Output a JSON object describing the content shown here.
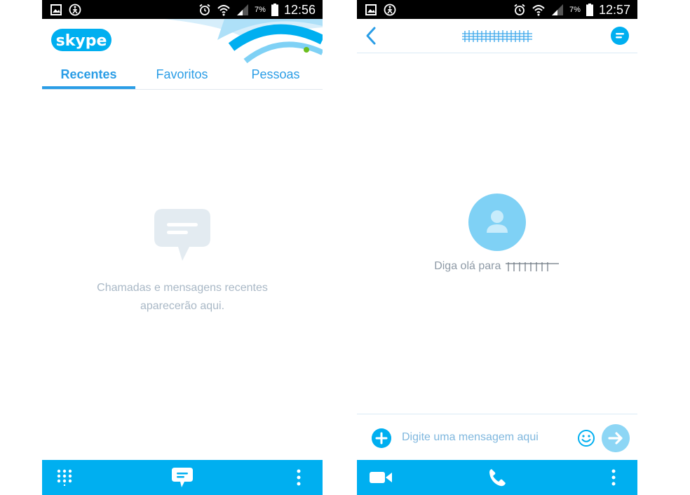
{
  "left_screen": {
    "status_bar": {
      "battery": "7%",
      "time": "12:56",
      "icons_left": [
        "image-icon",
        "person-running-icon"
      ],
      "icons_right": [
        "alarm-icon",
        "wifi-icon",
        "signal-icon",
        "battery-icon"
      ]
    },
    "logo_text": "skype",
    "tabs": [
      {
        "label": "Recentes",
        "active": true
      },
      {
        "label": "Favoritos",
        "active": false
      },
      {
        "label": "Pessoas",
        "active": false
      }
    ],
    "empty_state": {
      "line1": "Chamadas e mensagens recentes",
      "line2": "aparecerão aqui."
    },
    "bottom_bar": [
      "dialpad-icon",
      "chat-icon",
      "more-vertical-icon"
    ]
  },
  "right_screen": {
    "status_bar": {
      "battery": "7%",
      "time": "12:57",
      "icons_left": [
        "image-icon",
        "person-running-icon"
      ],
      "icons_right": [
        "alarm-icon",
        "wifi-icon",
        "signal-icon",
        "battery-icon"
      ]
    },
    "contact_name": "",
    "greeting": "Diga olá para",
    "message_input": {
      "placeholder": "Digite uma mensagem aqui",
      "value": ""
    },
    "bottom_bar": [
      "video-call-icon",
      "phone-icon",
      "more-vertical-icon"
    ]
  },
  "colors": {
    "accent": "#00aff0",
    "tab_text": "#2a9de6",
    "online": "#6cbe1e",
    "muted_text": "#a9b8c6",
    "avatar": "#7fd1f5"
  }
}
